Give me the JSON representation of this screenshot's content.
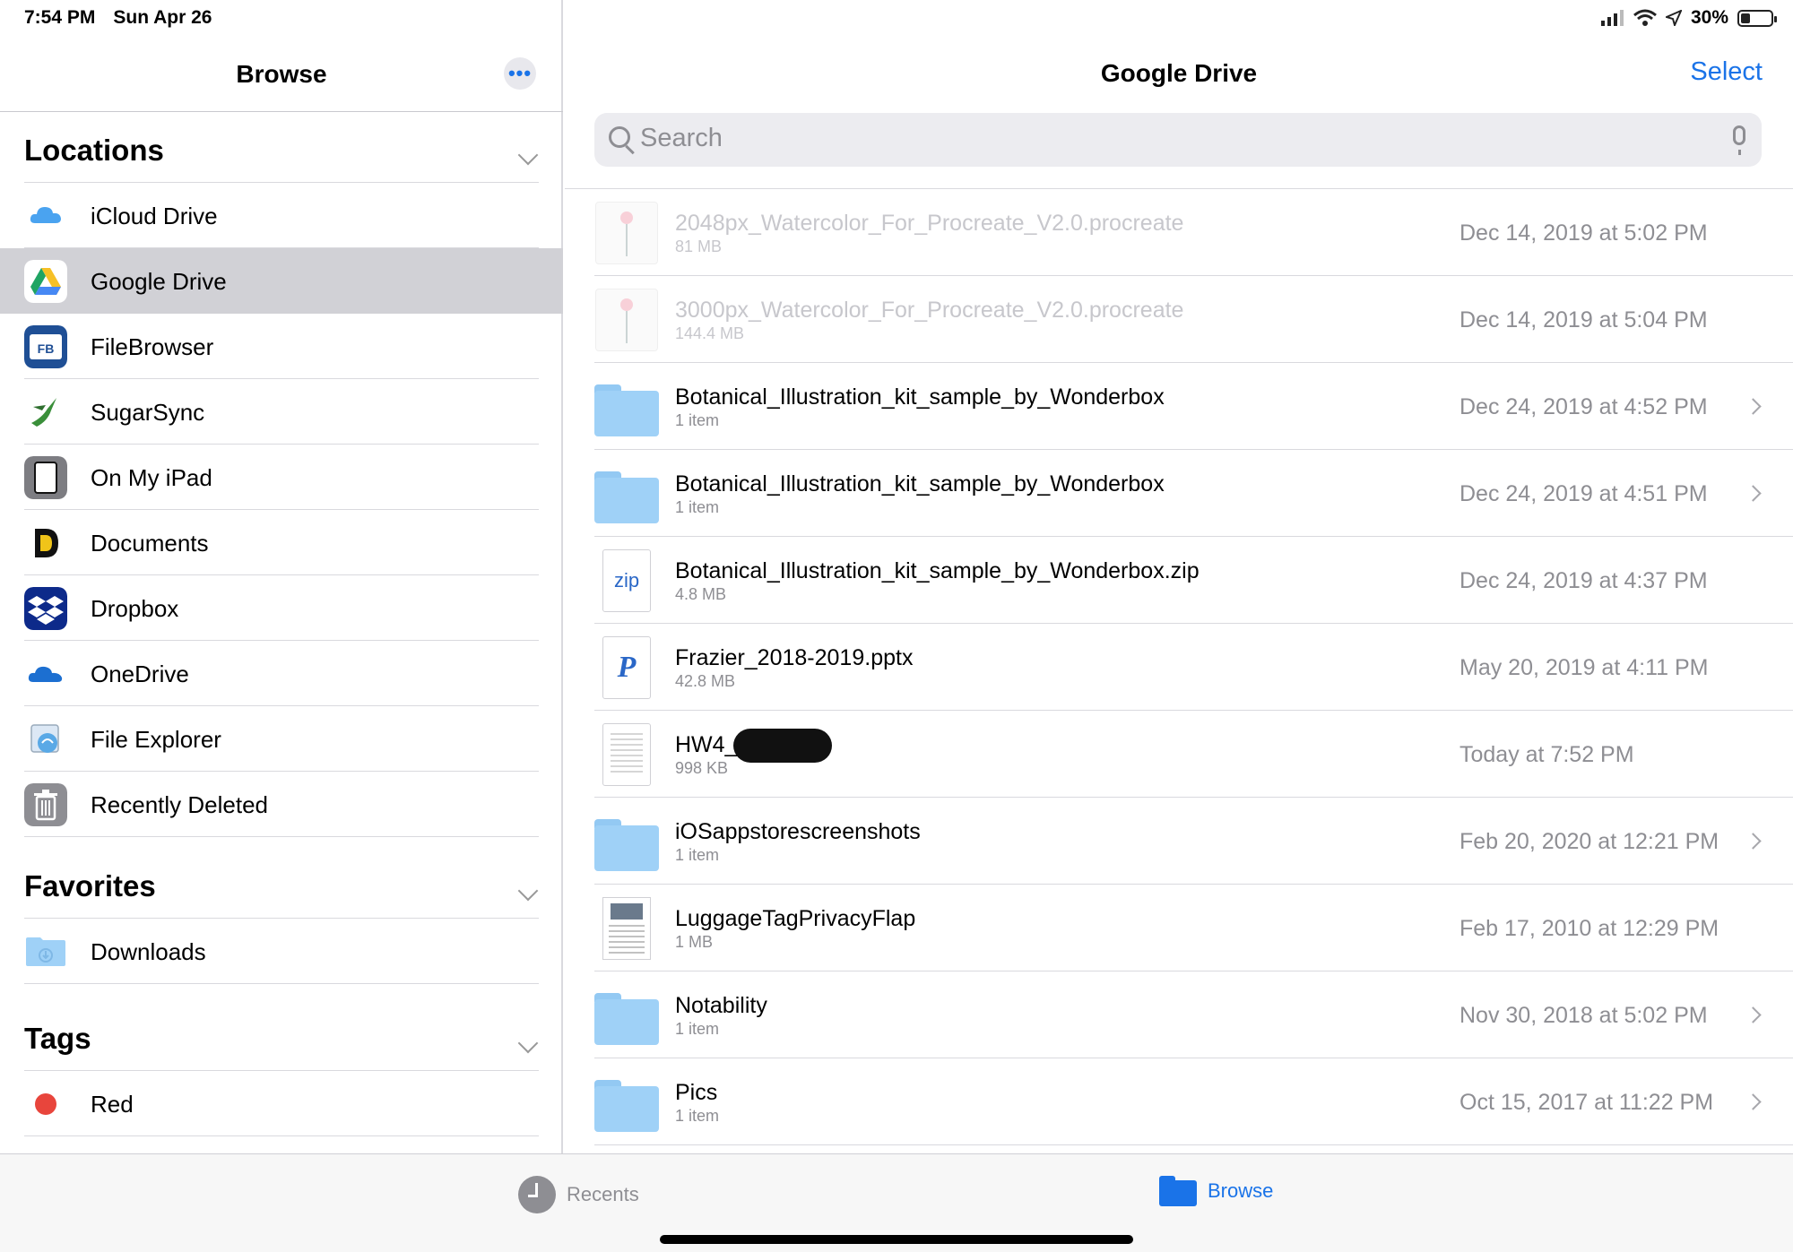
{
  "status": {
    "time": "7:54 PM",
    "date": "Sun Apr 26",
    "battery": "30%",
    "battery_level": 0.3
  },
  "sidebar": {
    "title": "Browse",
    "more_label": "•••",
    "locations_title": "Locations",
    "locations": [
      {
        "label": "iCloud Drive",
        "icon": "icloud-icon"
      },
      {
        "label": "Google Drive",
        "icon": "google-drive-icon",
        "selected": true
      },
      {
        "label": "FileBrowser",
        "icon": "filebrowser-icon",
        "icon_text": "FB"
      },
      {
        "label": "SugarSync",
        "icon": "sugarsync-icon"
      },
      {
        "label": "On My iPad",
        "icon": "ipad-icon"
      },
      {
        "label": "Documents",
        "icon": "documents-icon",
        "icon_text": "D"
      },
      {
        "label": "Dropbox",
        "icon": "dropbox-icon"
      },
      {
        "label": "OneDrive",
        "icon": "onedrive-icon"
      },
      {
        "label": "File Explorer",
        "icon": "file-explorer-icon"
      },
      {
        "label": "Recently Deleted",
        "icon": "trash-icon"
      }
    ],
    "favorites_title": "Favorites",
    "favorites": [
      {
        "label": "Downloads",
        "icon": "downloads-folder-icon"
      }
    ],
    "tags_title": "Tags",
    "tags": [
      {
        "label": "Red",
        "color": "#e8453c"
      }
    ]
  },
  "main": {
    "title": "Google Drive",
    "select_label": "Select",
    "search_placeholder": "Search",
    "files": [
      {
        "name": "2048px_Watercolor_For_Procreate_V2.0.procreate",
        "meta": "81 MB",
        "date": "Dec 14, 2019 at 5:02 PM",
        "kind": "procreate",
        "dim": true
      },
      {
        "name": "3000px_Watercolor_For_Procreate_V2.0.procreate",
        "meta": "144.4 MB",
        "date": "Dec 14, 2019 at 5:04 PM",
        "kind": "procreate",
        "dim": true
      },
      {
        "name": "Botanical_Illustration_kit_sample_by_Wonderbox",
        "meta": "1 item",
        "date": "Dec 24, 2019 at 4:52 PM",
        "kind": "folder"
      },
      {
        "name": "Botanical_Illustration_kit_sample_by_Wonderbox",
        "meta": "1 item",
        "date": "Dec 24, 2019 at 4:51 PM",
        "kind": "folder"
      },
      {
        "name": "Botanical_Illustration_kit_sample_by_Wonderbox.zip",
        "meta": "4.8 MB",
        "date": "Dec 24, 2019 at 4:37 PM",
        "kind": "zip",
        "thumb_text": "zip"
      },
      {
        "name": "Frazier_2018-2019.pptx",
        "meta": "42.8 MB",
        "date": "May 20, 2019 at 4:11 PM",
        "kind": "pptx",
        "thumb_text": "P"
      },
      {
        "name": "HW4_",
        "meta": "998 KB",
        "date": "Today at 7:52 PM",
        "kind": "pdf",
        "redacted": true
      },
      {
        "name": "iOSappstorescreenshots",
        "meta": "1 item",
        "date": "Feb 20, 2020 at 12:21 PM",
        "kind": "folder"
      },
      {
        "name": "LuggageTagPrivacyFlap",
        "meta": "1 MB",
        "date": "Feb 17, 2010 at 12:29 PM",
        "kind": "luggage"
      },
      {
        "name": "Notability",
        "meta": "1 item",
        "date": "Nov 30, 2018 at 5:02 PM",
        "kind": "folder"
      },
      {
        "name": "Pics",
        "meta": "1 item",
        "date": "Oct 15, 2017 at 11:22 PM",
        "kind": "folder"
      }
    ]
  },
  "tabbar": {
    "recents_label": "Recents",
    "browse_label": "Browse"
  },
  "colors": {
    "accent": "#1a73e8",
    "selected_row": "#d1d1d6",
    "folder": "#9fd1f7"
  }
}
